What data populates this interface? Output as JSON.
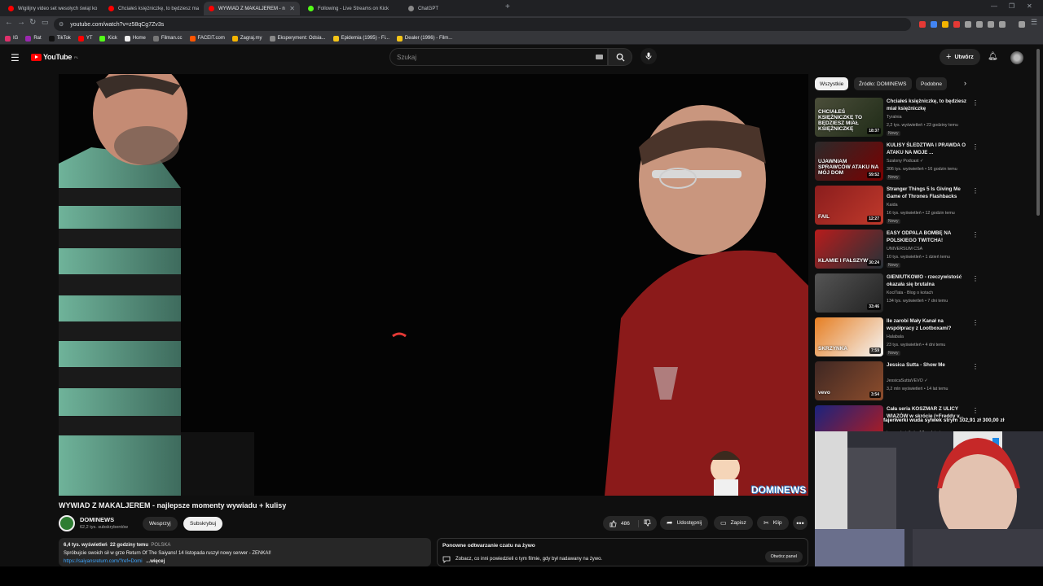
{
  "browser": {
    "tabs": [
      {
        "title": "Wigilijny video set wesołych świąt ko",
        "color": "#ff0000"
      },
      {
        "title": "Chciałeś księżniczkę, to będziesz ma",
        "color": "#ff0000"
      },
      {
        "title": "WYWIAD Z MAKALJEREM - n",
        "color": "#ff0000"
      },
      {
        "title": "Following - Live Streams on Kick",
        "color": "#53fc18"
      },
      {
        "title": "ChatGPT",
        "color": "#888888"
      }
    ],
    "url": "youtube.com/watch?v=z58qCg7Zv3s",
    "bookmarks": [
      {
        "label": "IG",
        "color": "#e1306c"
      },
      {
        "label": "Rat",
        "color": "#9c27b0"
      },
      {
        "label": "TikTok",
        "color": "#111111"
      },
      {
        "label": "YT",
        "color": "#ff0000"
      },
      {
        "label": "Kick",
        "color": "#53fc18"
      },
      {
        "label": "Home",
        "color": "#eeeeee"
      },
      {
        "label": "Filman.cc",
        "color": "#777777"
      },
      {
        "label": "FACEIT.com",
        "color": "#ff5500"
      },
      {
        "label": "Zagraj.my",
        "color": "#f4b400"
      },
      {
        "label": "Eksperyment: Odsia...",
        "color": "#888888"
      },
      {
        "label": "Epidemia (1995) - Fi...",
        "color": "#f5c518"
      },
      {
        "label": "Dealer (1996) - Film...",
        "color": "#f5c518"
      }
    ]
  },
  "masthead": {
    "logo": "YouTube",
    "region": "PL",
    "search_placeholder": "Szukaj",
    "create_label": "Utwórz"
  },
  "video": {
    "watermark": "DOMINEWS",
    "title": "WYWIAD Z MAKALJEREM - najlepsze momenty wywiadu + kulisy",
    "channel": "DOMINEWS",
    "subscribers": "62,2 tys. subskrybentów",
    "support_label": "Wesprzyj",
    "subscribe_label": "Subskrybuj",
    "likes": "486",
    "share_label": "Udostępnij",
    "save_label": "Zapisz",
    "clip_label": "Klip",
    "more_label": "•••"
  },
  "description": {
    "views": "6,4 tys. wyświetleń",
    "age": "22 godziny temu",
    "country": "POLSKA",
    "line1": "Spróbujcie swoich sił w grze Return Of The Saiyans! 14 listopada ruszył nowy serwer - ZENKAI!",
    "link": "https://saiyansreturn.com/?ref=Domi",
    "more": "...więcej"
  },
  "chat_replay": {
    "heading": "Ponowne odtwarzanie czatu na żywo",
    "text": "Zobacz, co inni powiedzieli o tym filmie, gdy był nadawany na żywo.",
    "button": "Otwórz panel"
  },
  "sidebar": {
    "chips": [
      {
        "label": "Wszystkie",
        "selected": true
      },
      {
        "label": "Źródło: DOMINEWS",
        "selected": false
      },
      {
        "label": "Podobne",
        "selected": false
      }
    ],
    "recommendations": [
      {
        "title": "Chciałeś księżniczkę, to będziesz miał księżniczkę",
        "channel": "Tyralnia",
        "views": "2,2 tys. wyświetleń • 23 godziny temu",
        "badge": "Nowy",
        "duration": "18:37",
        "thumb_text": "CHCIAŁEŚ KSIĘŻNICZKĘ TO BĘDZIESZ MIAŁ KSIĘŻNICZKĘ",
        "colors": [
          "#4b4e3a",
          "#1f2b17"
        ]
      },
      {
        "title": "KULISY ŚLEDZTWA I PRAWDA O ATAKU NA MOJE ...",
        "channel": "Szalony Podcast ✓",
        "views": "306 tys. wyświetleń • 16 godzin temu",
        "badge": "Nowy",
        "duration": "59:52",
        "thumb_text": "UJAWNIAM SPRAWCÓW ATAKU NA MÓJ DOM",
        "colors": [
          "#2a2a2a",
          "#7a0000"
        ]
      },
      {
        "title": "Stranger Things 5 Is Giving Me Game of Thrones Flashbacks",
        "channel": "Kaida",
        "views": "16 tys. wyświetleń • 12 godzin temu",
        "badge": "Nowy",
        "duration": "12:27",
        "thumb_text": "FAIL",
        "colors": [
          "#8a1d1d",
          "#c0392b"
        ]
      },
      {
        "title": "EASY ODPALA BOMBĘ NA POLSKIEGO TWITCHA!",
        "channel": "UNIVERSUM CSA",
        "views": "10 tys. wyświetleń • 1 dzień temu",
        "badge": "Nowy",
        "duration": "30:24",
        "thumb_text": "KŁAMIE I FAŁSZYW",
        "colors": [
          "#b71c1c",
          "#263238"
        ]
      },
      {
        "title": "GIENIUTKOWO - rzeczywistość okazała się brutalna",
        "channel": "KociTata - Blog o kotach",
        "views": "134 tys. wyświetleń • 7 dni temu",
        "badge": "",
        "duration": "33:46",
        "thumb_text": "",
        "colors": [
          "#555555",
          "#222222"
        ]
      },
      {
        "title": "Ile zarobi Mały Kanał na współpracy z Lootboxami?",
        "channel": "Halabala",
        "views": "23 tys. wyświetleń • 4 dni temu",
        "badge": "Nowy",
        "duration": "7:59",
        "thumb_text": "SKRZYNKA",
        "colors": [
          "#e67e22",
          "#f5f5f5"
        ]
      },
      {
        "title": "Jessica Sutta - Show Me",
        "channel": "JessicaSuttaVEVO ✓",
        "views": "3,2 mln wyświetleń • 14 lat temu",
        "badge": "",
        "duration": "3:54",
        "thumb_text": "vevo",
        "colors": [
          "#3e2723",
          "#8d4d2c"
        ]
      },
      {
        "title": "Cała seria KOSZMAR Z ULICY WIĄZÓW w skrócie (+Freddy v...",
        "channel": "",
        "views": "tys. wyświetleń • 17 godzin temu",
        "badge": "",
        "duration": "",
        "thumb_text": "SKRÓT SERII",
        "colors": [
          "#1a237e",
          "#b71c1c"
        ]
      }
    ]
  },
  "overlay": {
    "donation": "fajerwerki wuda sylwek strym 102,91 zł   300,00 zł"
  }
}
